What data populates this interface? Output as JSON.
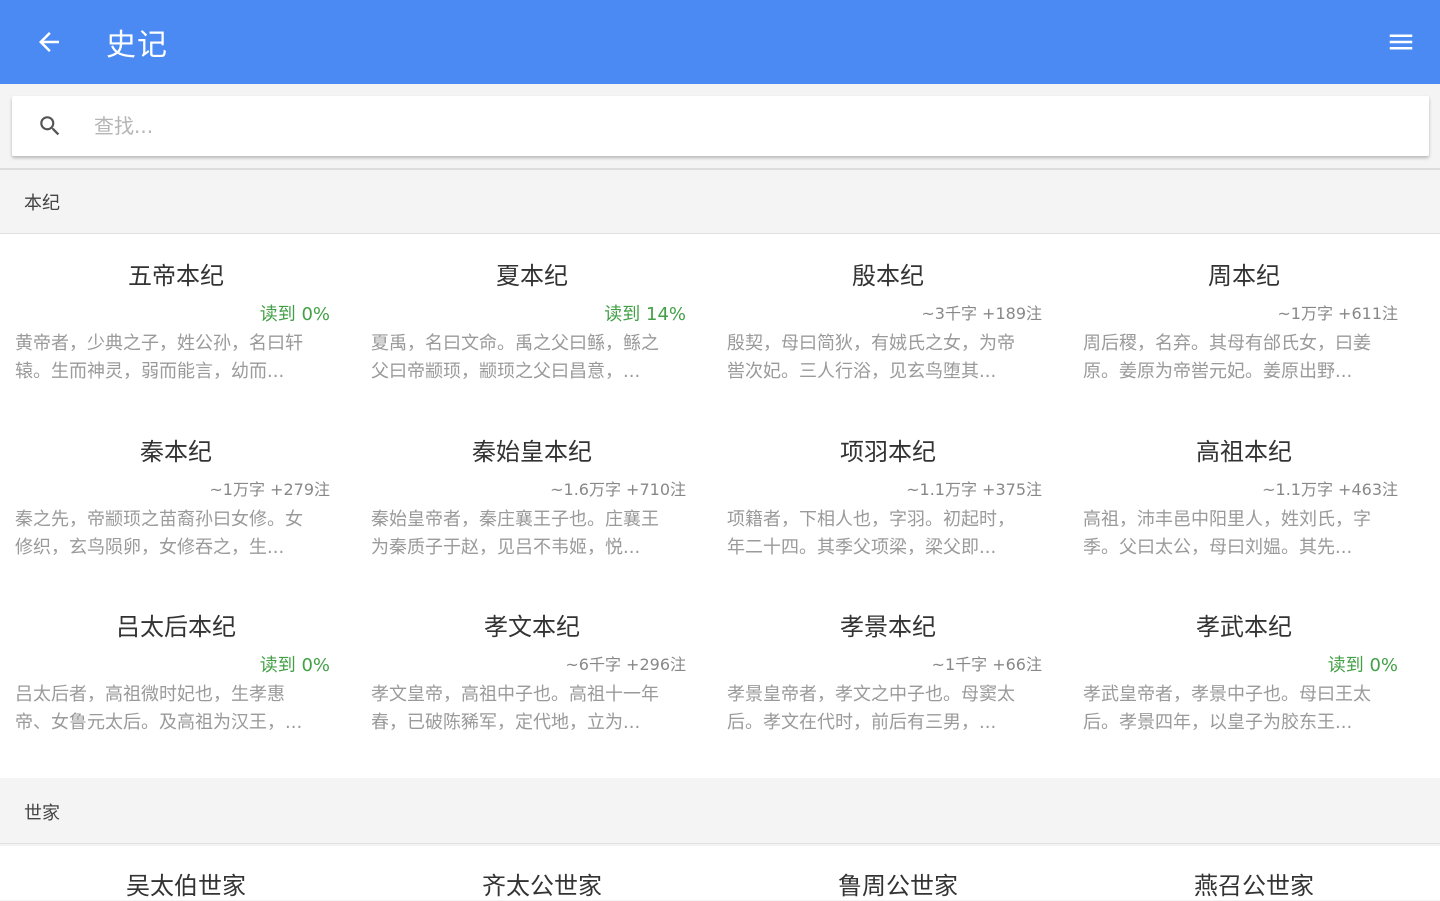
{
  "appbar": {
    "title": "史记",
    "bg_color": "#4a8af2"
  },
  "search": {
    "placeholder": "查找..."
  },
  "sections": [
    {
      "name": "本纪",
      "books": [
        {
          "title": "五帝本纪",
          "meta": "读到 0%",
          "read": true,
          "excerpt": "黄帝者，少典之子，姓公孙，名曰轩\n辕。生而神灵，弱而能言，幼而..."
        },
        {
          "title": "夏本纪",
          "meta": "读到 14%",
          "read": true,
          "excerpt": "夏禹，名曰文命。禹之父曰鲧，鲧之\n父曰帝颛顼，颛顼之父曰昌意，..."
        },
        {
          "title": "殷本纪",
          "meta": "~3千字 +189注",
          "read": false,
          "excerpt": "殷契，母曰简狄，有娀氏之女，为帝\n喾次妃。三人行浴，见玄鸟堕其..."
        },
        {
          "title": "周本纪",
          "meta": "~1万字 +611注",
          "read": false,
          "excerpt": "周后稷，名弃。其母有邰氏女，曰姜\n原。姜原为帝喾元妃。姜原出野..."
        },
        {
          "title": "秦本纪",
          "meta": "~1万字 +279注",
          "read": false,
          "excerpt": "秦之先，帝颛顼之苗裔孙曰女修。女\n修织，玄鸟陨卵，女修吞之，生..."
        },
        {
          "title": "秦始皇本纪",
          "meta": "~1.6万字 +710注",
          "read": false,
          "excerpt": "秦始皇帝者，秦庄襄王子也。庄襄王\n为秦质子于赵，见吕不韦姬，悦..."
        },
        {
          "title": "项羽本纪",
          "meta": "~1.1万字 +375注",
          "read": false,
          "excerpt": "项籍者，下相人也，字羽。初起时，\n年二十四。其季父项梁，梁父即..."
        },
        {
          "title": "高祖本纪",
          "meta": "~1.1万字 +463注",
          "read": false,
          "excerpt": "高祖，沛丰邑中阳里人，姓刘氏，字\n季。父曰太公，母曰刘媪。其先..."
        },
        {
          "title": "吕太后本纪",
          "meta": "读到 0%",
          "read": true,
          "excerpt": "吕太后者，高祖微时妃也，生孝惠\n帝、女鲁元太后。及高祖为汉王，..."
        },
        {
          "title": "孝文本纪",
          "meta": "~6千字 +296注",
          "read": false,
          "excerpt": "孝文皇帝，高祖中子也。高祖十一年\n春，已破陈豨军，定代地，立为..."
        },
        {
          "title": "孝景本纪",
          "meta": "~1千字 +66注",
          "read": false,
          "excerpt": "孝景皇帝者，孝文之中子也。母窦太\n后。孝文在代时，前后有三男，..."
        },
        {
          "title": "孝武本纪",
          "meta": "读到 0%",
          "read": true,
          "excerpt": "孝武皇帝者，孝景中子也。母曰王太\n后。孝景四年，以皇子为胶东王..."
        }
      ]
    },
    {
      "name": "世家",
      "books": [
        {
          "title": "吴太伯世家"
        },
        {
          "title": "齐太公世家"
        },
        {
          "title": "鲁周公世家"
        },
        {
          "title": "燕召公世家"
        }
      ]
    }
  ]
}
